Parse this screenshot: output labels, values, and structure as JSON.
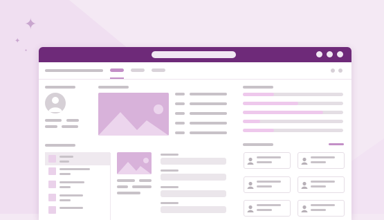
{
  "illustration": {
    "kind": "wireframe dashboard",
    "colors": {
      "background": "#f4e9f4",
      "title_bar": "#6e2a79",
      "accent": "#c38fc7",
      "image_placeholder": "#d8b2da",
      "progress_fill": "#eec8ec",
      "placeholder_text": "#c8c2c8"
    },
    "icons": [
      "sparkle-icon",
      "image-placeholder-icon",
      "user-avatar-icon"
    ]
  },
  "progress": {
    "fills": [
      0.31,
      0.55,
      0.8,
      0.17,
      0.31
    ]
  }
}
